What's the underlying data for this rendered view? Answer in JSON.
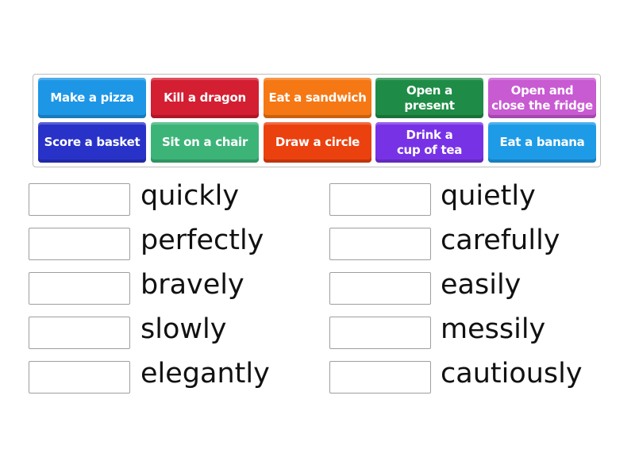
{
  "tiles": [
    {
      "label": "Make a pizza",
      "color": "#1e96e6"
    },
    {
      "label": "Kill a dragon",
      "color": "#d41e32"
    },
    {
      "label": "Eat a sandwich",
      "color": "#f57814"
    },
    {
      "label": "Open a\npresent",
      "color": "#1e8c46"
    },
    {
      "label": "Open and\nclose the fridge",
      "color": "#c85ad2"
    },
    {
      "label": "Score a basket",
      "color": "#2832c8"
    },
    {
      "label": "Sit on a chair",
      "color": "#3cb478"
    },
    {
      "label": "Draw a circle",
      "color": "#eb410f"
    },
    {
      "label": "Drink a\ncup of tea",
      "color": "#7832e6"
    },
    {
      "label": "Eat a banana",
      "color": "#1e9be6"
    }
  ],
  "left_words": [
    "quickly",
    "perfectly",
    "bravely",
    "slowly",
    "elegantly"
  ],
  "right_words": [
    "quietly",
    "carefully",
    "easily",
    "messily",
    "cautiously"
  ]
}
